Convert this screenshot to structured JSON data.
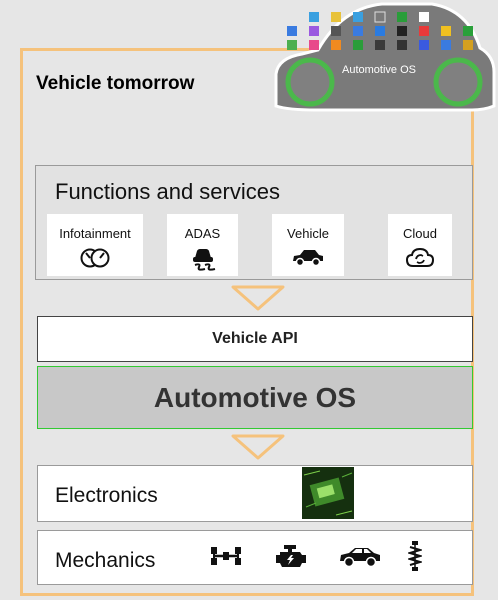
{
  "title": "Vehicle tomorrow",
  "car_label": "Automotive OS",
  "functions": {
    "title": "Functions and services",
    "tiles": [
      {
        "label": "Infotainment",
        "icon": "gauges-icon"
      },
      {
        "label": "ADAS",
        "icon": "skidding-car-icon"
      },
      {
        "label": "Vehicle",
        "icon": "car-icon"
      },
      {
        "label": "Cloud",
        "icon": "cloud-sync-icon"
      }
    ]
  },
  "api_label": "Vehicle API",
  "os_label": "Automotive OS",
  "electronics": {
    "label": "Electronics",
    "icon": "circuit-board-icon"
  },
  "mechanics": {
    "label": "Mechanics",
    "icons": [
      "axle-icon",
      "engine-icon",
      "car-icon",
      "suspension-icon"
    ]
  },
  "colors": {
    "frame": "#f5c27c",
    "os_border": "#33c933",
    "arrow": "#f5c27c"
  }
}
